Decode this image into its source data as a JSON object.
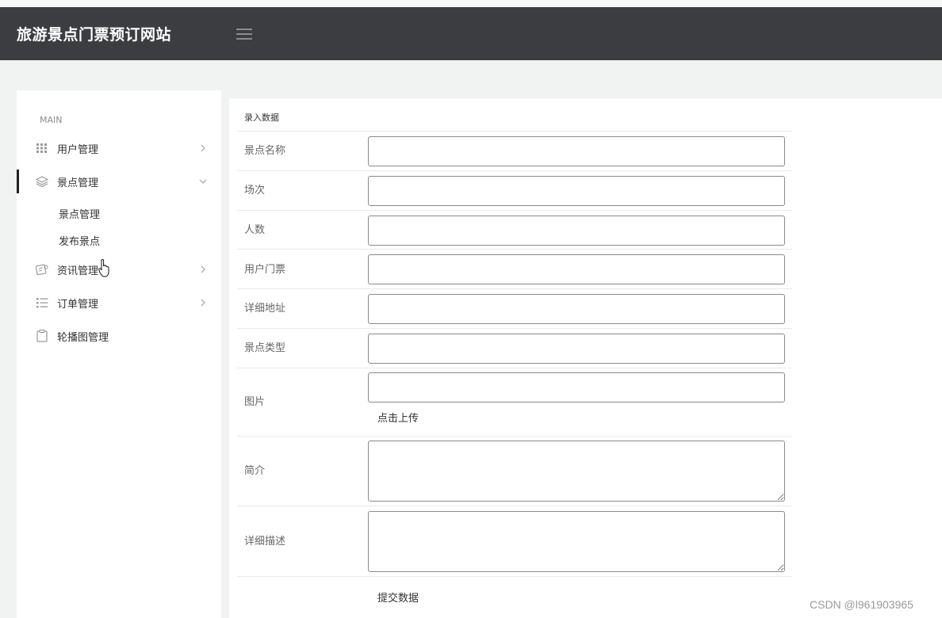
{
  "header": {
    "site_title": "旅游景点门票预订网站",
    "menu_icon": "hamburger-menu-icon"
  },
  "sidebar": {
    "section_label": "MAIN",
    "items": [
      {
        "label": "用户管理",
        "icon": "grid-icon",
        "expanded": false
      },
      {
        "label": "景点管理",
        "icon": "layers-icon",
        "expanded": true,
        "children": [
          {
            "label": "景点管理"
          },
          {
            "label": "发布景点"
          }
        ]
      },
      {
        "label": "资讯管理",
        "icon": "news-icon",
        "expanded": false
      },
      {
        "label": "订单管理",
        "icon": "list-icon",
        "expanded": false
      },
      {
        "label": "轮播图管理",
        "icon": "clipboard-icon",
        "expanded": false
      }
    ]
  },
  "form": {
    "heading": "录入数据",
    "fields": [
      {
        "label": "景点名称",
        "value": ""
      },
      {
        "label": "场次",
        "value": ""
      },
      {
        "label": "人数",
        "value": ""
      },
      {
        "label": "用户门票",
        "value": ""
      },
      {
        "label": "详细地址",
        "value": ""
      },
      {
        "label": "景点类型",
        "value": ""
      },
      {
        "label": "图片",
        "value": ""
      },
      {
        "label": "简介",
        "value": ""
      },
      {
        "label": "详细描述",
        "value": ""
      }
    ],
    "upload_label": "点击上传",
    "submit_label": "提交数据"
  },
  "watermark": "CSDN @l961903965",
  "colors": {
    "header_bg": "#3b3d41",
    "page_bg": "#f1f2f2",
    "panel_bg": "#ffffff",
    "input_border": "#8a8a8a"
  }
}
